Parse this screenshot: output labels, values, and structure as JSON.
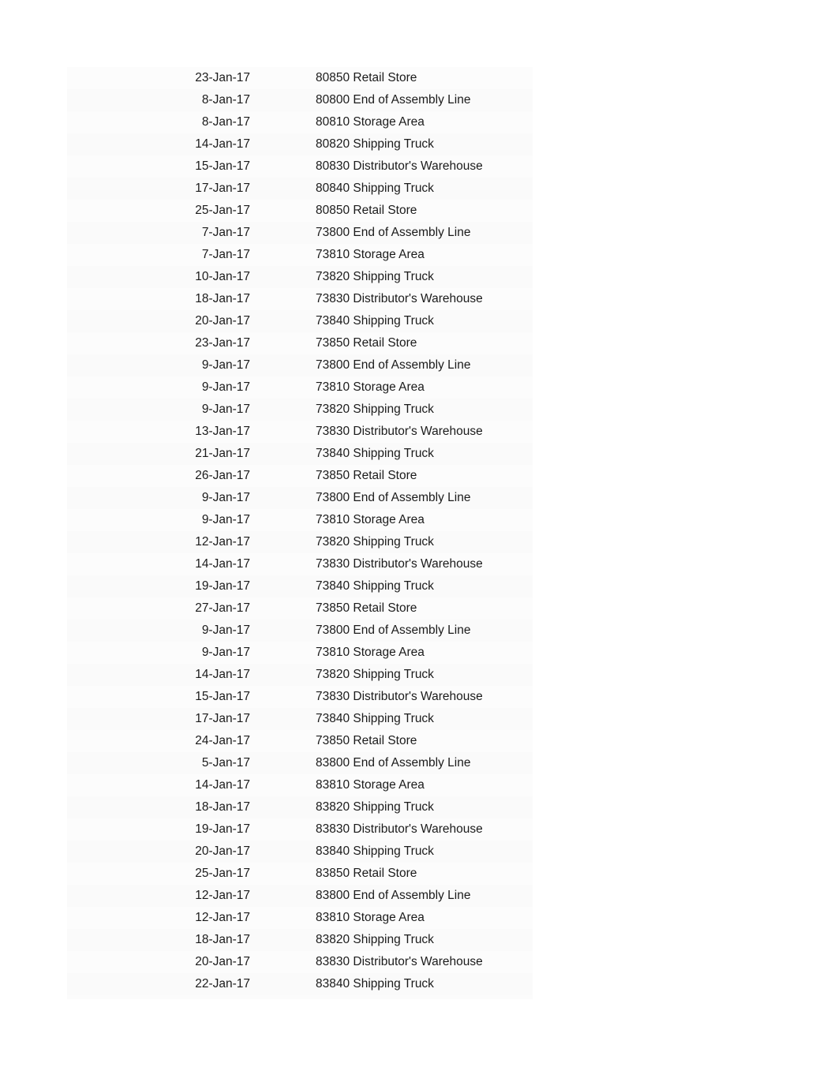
{
  "sheet": {
    "columns": {
      "blank_label": "",
      "date_label": "",
      "gap_label": "",
      "location_label": ""
    },
    "rows": [
      {
        "date": "23-Jan-17",
        "location": "80850 Retail Store"
      },
      {
        "date": "8-Jan-17",
        "location": "80800 End of Assembly Line"
      },
      {
        "date": "8-Jan-17",
        "location": "80810 Storage Area"
      },
      {
        "date": "14-Jan-17",
        "location": "80820 Shipping Truck"
      },
      {
        "date": "15-Jan-17",
        "location": "80830 Distributor's Warehouse"
      },
      {
        "date": "17-Jan-17",
        "location": "80840 Shipping Truck"
      },
      {
        "date": "25-Jan-17",
        "location": "80850 Retail Store"
      },
      {
        "date": "7-Jan-17",
        "location": "73800 End of Assembly Line"
      },
      {
        "date": "7-Jan-17",
        "location": "73810 Storage Area"
      },
      {
        "date": "10-Jan-17",
        "location": "73820 Shipping Truck"
      },
      {
        "date": "18-Jan-17",
        "location": "73830 Distributor's Warehouse"
      },
      {
        "date": "20-Jan-17",
        "location": "73840 Shipping Truck"
      },
      {
        "date": "23-Jan-17",
        "location": "73850 Retail Store"
      },
      {
        "date": "9-Jan-17",
        "location": "73800 End of Assembly Line"
      },
      {
        "date": "9-Jan-17",
        "location": "73810 Storage Area"
      },
      {
        "date": "9-Jan-17",
        "location": "73820 Shipping Truck"
      },
      {
        "date": "13-Jan-17",
        "location": "73830 Distributor's Warehouse"
      },
      {
        "date": "21-Jan-17",
        "location": "73840 Shipping Truck"
      },
      {
        "date": "26-Jan-17",
        "location": "73850 Retail Store"
      },
      {
        "date": "9-Jan-17",
        "location": "73800 End of Assembly Line"
      },
      {
        "date": "9-Jan-17",
        "location": "73810 Storage Area"
      },
      {
        "date": "12-Jan-17",
        "location": "73820 Shipping Truck"
      },
      {
        "date": "14-Jan-17",
        "location": "73830 Distributor's Warehouse"
      },
      {
        "date": "19-Jan-17",
        "location": "73840 Shipping Truck"
      },
      {
        "date": "27-Jan-17",
        "location": "73850 Retail Store"
      },
      {
        "date": "9-Jan-17",
        "location": "73800 End of Assembly Line"
      },
      {
        "date": "9-Jan-17",
        "location": "73810 Storage Area"
      },
      {
        "date": "14-Jan-17",
        "location": "73820 Shipping Truck"
      },
      {
        "date": "15-Jan-17",
        "location": "73830 Distributor's Warehouse"
      },
      {
        "date": "17-Jan-17",
        "location": "73840 Shipping Truck"
      },
      {
        "date": "24-Jan-17",
        "location": "73850 Retail Store"
      },
      {
        "date": "5-Jan-17",
        "location": "83800 End of Assembly Line"
      },
      {
        "date": "14-Jan-17",
        "location": "83810 Storage Area"
      },
      {
        "date": "18-Jan-17",
        "location": "83820 Shipping Truck"
      },
      {
        "date": "19-Jan-17",
        "location": "83830 Distributor's Warehouse"
      },
      {
        "date": "20-Jan-17",
        "location": "83840 Shipping Truck"
      },
      {
        "date": "25-Jan-17",
        "location": "83850 Retail Store"
      },
      {
        "date": "12-Jan-17",
        "location": "83800 End of Assembly Line"
      },
      {
        "date": "12-Jan-17",
        "location": "83810 Storage Area"
      },
      {
        "date": "18-Jan-17",
        "location": "83820 Shipping Truck"
      },
      {
        "date": "20-Jan-17",
        "location": "83830 Distributor's Warehouse"
      },
      {
        "date": "22-Jan-17",
        "location": "83840 Shipping Truck"
      }
    ]
  }
}
